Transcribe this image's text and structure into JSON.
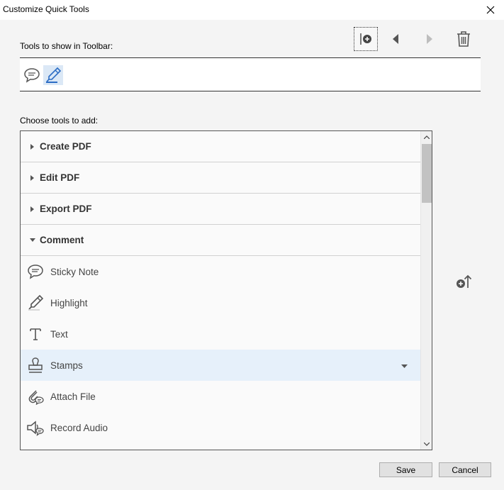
{
  "dialog": {
    "title": "Customize Quick Tools"
  },
  "toolbar_section": {
    "label": "Tools to show in Toolbar:",
    "buttons": [
      {
        "name": "add-separator",
        "icon": "add-separator-icon"
      },
      {
        "name": "move-left",
        "icon": "triangle-left-icon"
      },
      {
        "name": "move-right",
        "icon": "triangle-right-icon"
      },
      {
        "name": "delete",
        "icon": "trash-icon"
      }
    ],
    "tools": [
      {
        "name": "sticky-note",
        "icon": "comment-bubble-icon",
        "selected": false
      },
      {
        "name": "highlight",
        "icon": "highlighter-pen-icon",
        "selected": true
      }
    ]
  },
  "choose_section": {
    "label": "Choose tools to add:",
    "categories": [
      {
        "label": "Create PDF",
        "expanded": false
      },
      {
        "label": "Edit PDF",
        "expanded": false
      },
      {
        "label": "Export PDF",
        "expanded": false
      },
      {
        "label": "Comment",
        "expanded": true
      }
    ],
    "comment_tools": [
      {
        "label": "Sticky Note",
        "icon": "sticky-note-icon"
      },
      {
        "label": "Highlight",
        "icon": "highlight-icon"
      },
      {
        "label": "Text",
        "icon": "text-icon"
      },
      {
        "label": "Stamps",
        "icon": "stamp-icon",
        "highlighted": true,
        "has_dropdown": true
      },
      {
        "label": "Attach File",
        "icon": "attach-file-icon"
      },
      {
        "label": "Record Audio",
        "icon": "record-audio-icon"
      }
    ]
  },
  "buttons": {
    "save": "Save",
    "cancel": "Cancel"
  },
  "colors": {
    "accent": "#2b6cc4",
    "selection": "#e6f0fa",
    "icon": "#555555"
  }
}
